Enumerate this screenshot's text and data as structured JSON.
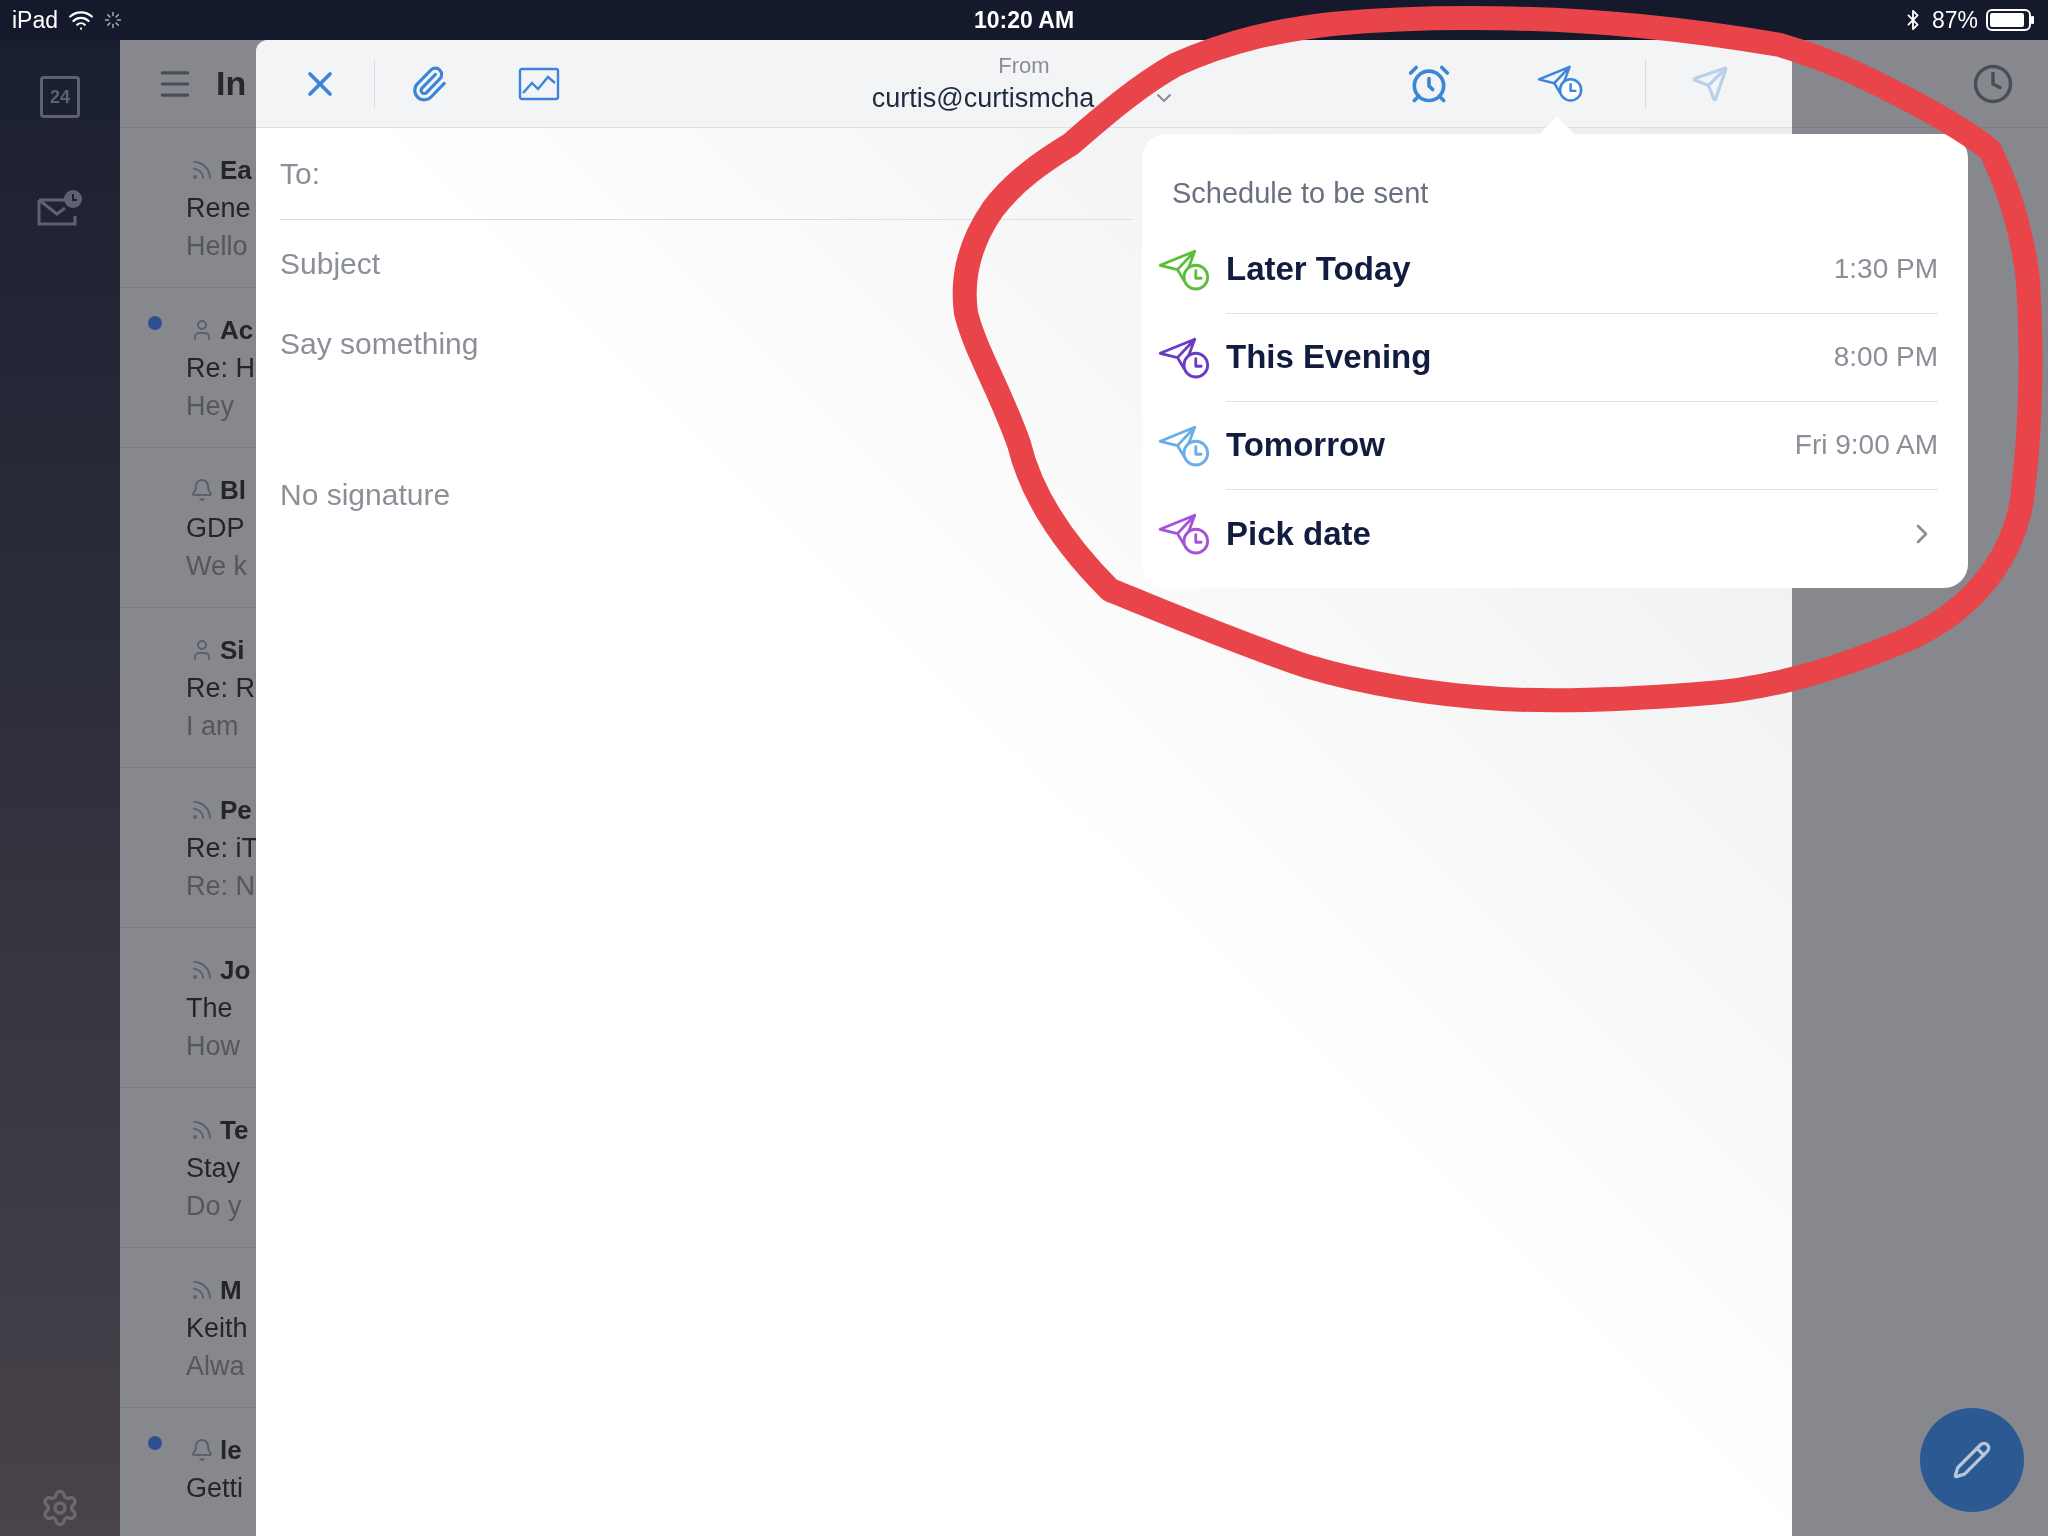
{
  "status_bar": {
    "device": "iPad",
    "time": "10:20 AM",
    "battery": "87%"
  },
  "sidebar": {
    "calendar_day": "24"
  },
  "mail_list": {
    "title": "In",
    "messages": [
      {
        "kind": "rss",
        "unread": false,
        "sender": "Ea",
        "subject": "Rene",
        "preview": "Hello"
      },
      {
        "kind": "person",
        "unread": true,
        "sender": "Ac",
        "subject": "Re: H",
        "preview": "Hey"
      },
      {
        "kind": "bell",
        "unread": false,
        "sender": "Bl",
        "subject": "GDP",
        "preview": "We k"
      },
      {
        "kind": "person",
        "unread": false,
        "sender": "Si",
        "subject": "Re: R",
        "preview": "I am"
      },
      {
        "kind": "rss",
        "unread": false,
        "sender": "Pe",
        "subject": "Re: iT",
        "preview": "Re: N"
      },
      {
        "kind": "rss",
        "unread": false,
        "sender": "Jo",
        "subject": "The",
        "preview": "How"
      },
      {
        "kind": "rss",
        "unread": false,
        "sender": "Te",
        "subject": "Stay",
        "preview": "Do y"
      },
      {
        "kind": "rss",
        "unread": false,
        "sender": "M",
        "subject": "Keith",
        "preview": "Alwa"
      },
      {
        "kind": "bell",
        "unread": true,
        "sender": "le",
        "subject": "Getti"
      }
    ]
  },
  "compose": {
    "from_label": "From",
    "from_address": "curtis@curtismcha",
    "to_label": "To:",
    "subject_placeholder": "Subject",
    "body_placeholder": "Say something",
    "signature": "No signature",
    "send_later": {
      "selected": true
    },
    "send": {
      "disabled": true
    }
  },
  "schedule_popover": {
    "title": "Schedule to be sent",
    "options": [
      {
        "kind": "time",
        "label": "Later Today",
        "time": "1:30 PM",
        "color": "#5bbd3a"
      },
      {
        "kind": "time",
        "label": "This Evening",
        "time": "8:00 PM",
        "color": "#6a3cc6"
      },
      {
        "kind": "time",
        "label": "Tomorrow",
        "time": "Fri 9:00 AM",
        "color": "#6aaee8"
      },
      {
        "kind": "picker",
        "label": "Pick date",
        "color": "#a652d8"
      }
    ]
  }
}
